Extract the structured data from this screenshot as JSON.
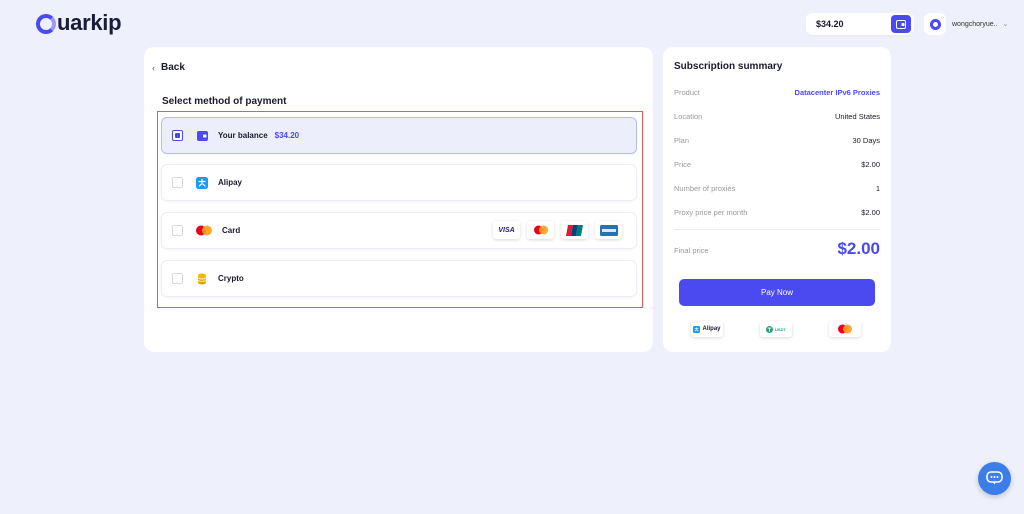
{
  "header": {
    "logo_text": "uarkip",
    "balance": "$34.20",
    "username": "wongchoryue.."
  },
  "left": {
    "back_label": "Back",
    "section_title": "Select method of payment",
    "options": [
      {
        "label": "Your balance",
        "amount": "$34.20",
        "selected": true
      },
      {
        "label": "Alipay",
        "selected": false
      },
      {
        "label": "Card",
        "selected": false
      },
      {
        "label": "Crypto",
        "selected": false
      }
    ],
    "card_brands": [
      "VISA",
      "Mastercard",
      "UnionPay",
      "AMEX"
    ]
  },
  "summary": {
    "title": "Subscription summary",
    "rows": [
      {
        "key": "Product",
        "value": "Datacenter IPv6 Proxies"
      },
      {
        "key": "Location",
        "value": "United States"
      },
      {
        "key": "Plan",
        "value": "30 Days"
      },
      {
        "key": "Price",
        "value": "$2.00"
      },
      {
        "key": "Number of proxies",
        "value": "1"
      },
      {
        "key": "Proxy price per month",
        "value": "$2.00"
      }
    ],
    "final_label": "Final price",
    "final_value": "$2.00",
    "pay_button": "Pay Now",
    "logos": [
      "Alipay",
      "USDT",
      "Mastercard"
    ]
  },
  "colors": {
    "accent": "#4a4af0",
    "highlight_border": "#e35c5c",
    "background": "#eef0fb"
  }
}
